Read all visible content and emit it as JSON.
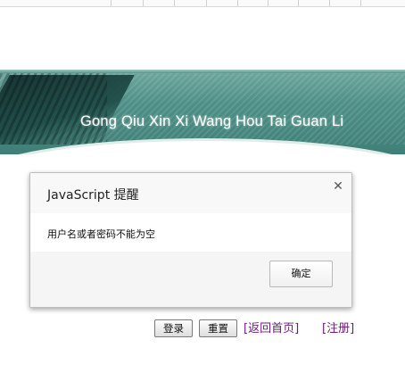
{
  "banner": {
    "title": "Gong Qiu Xin Xi Wang Hou Tai Guan Li"
  },
  "dialog": {
    "title": "JavaScript 提醒",
    "close_icon": "close-icon",
    "message": "用户名或者密码不能为空",
    "ok_label": "确定"
  },
  "form": {
    "login_label": "登录",
    "reset_label": "重置",
    "home_link": "[返回首页]",
    "register_link": "[注册]"
  },
  "colors": {
    "banner": "#4d8f86",
    "link": "#6a1b7a"
  }
}
